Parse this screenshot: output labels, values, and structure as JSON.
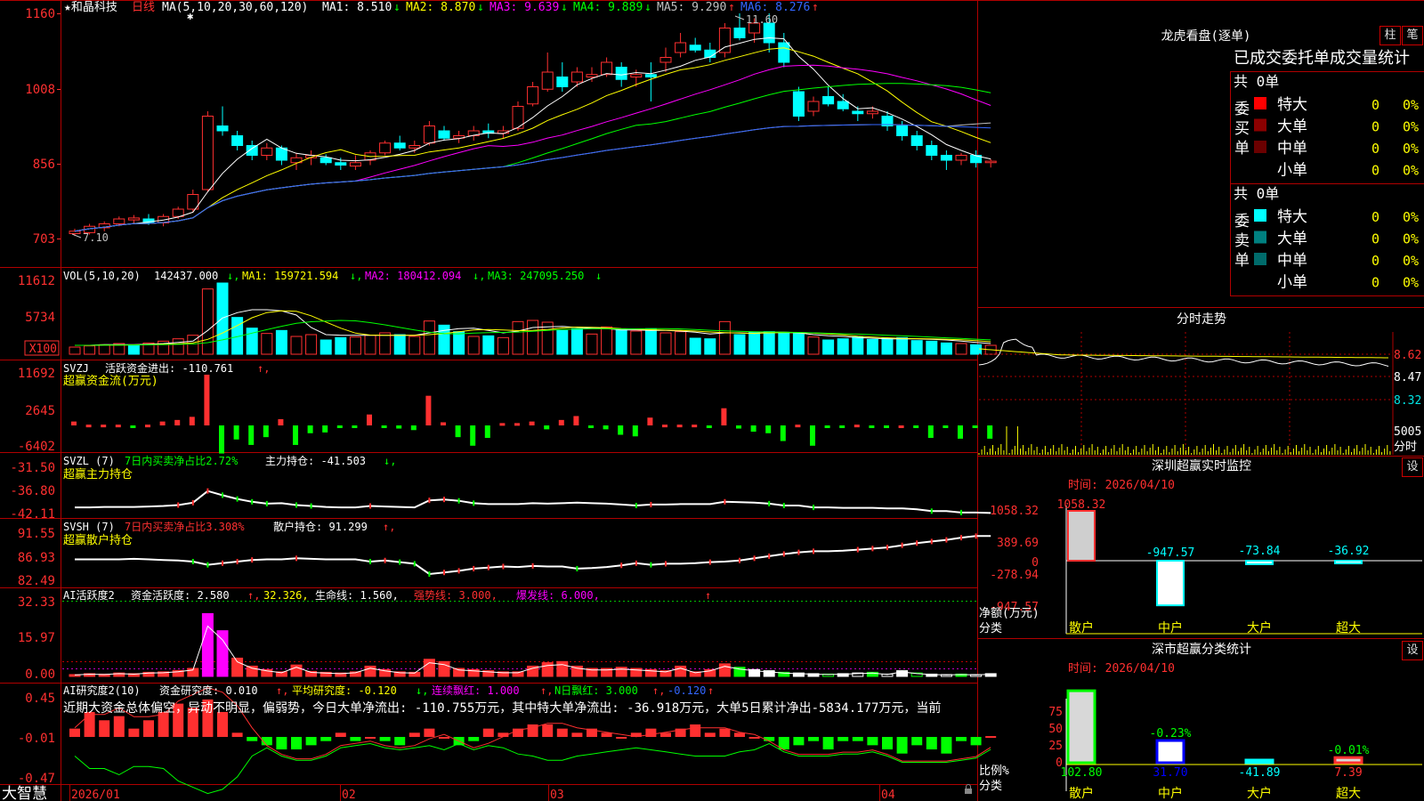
{
  "stock": {
    "title": "★和晶科技",
    "period": "日线",
    "ma_param": "MA(5,10,20,30,60,120)"
  },
  "ma_info": [
    {
      "label": "MA1: 8.510",
      "arrow": "↓",
      "color": "#ffffff"
    },
    {
      "label": "MA2: 8.870",
      "arrow": "↓",
      "color": "#ffff00"
    },
    {
      "label": "MA3: 9.639",
      "arrow": "↓",
      "color": "#ff00ff"
    },
    {
      "label": "MA4: 9.889",
      "arrow": "↓",
      "color": "#00ff00"
    },
    {
      "label": "MA5: 9.290",
      "arrow": "↑",
      "color": "#c0c0c0"
    },
    {
      "label": "MA6: 8.276",
      "arrow": "↑",
      "color": "#3366ff"
    }
  ],
  "price_axis": [
    "1160",
    "1008",
    "856",
    "703"
  ],
  "high_label": "11.60",
  "low_label": "7.10",
  "date_axis": [
    "2026/01",
    "02",
    "03",
    "04"
  ],
  "vol_info": {
    "name": "VOL(5,10,20)",
    "v": "142437.000",
    "ma1": "MA1: 159721.594",
    "ma2": "MA2: 180412.094",
    "ma3": "MA3: 247095.250"
  },
  "vol_axis": [
    "11612",
    "5734",
    "X100"
  ],
  "svzj": {
    "name": "SVZJ",
    "text": "活跃资金进出: -110.761",
    "sub": "超赢资金流(万元)",
    "axis": [
      "11692",
      "2645",
      "-6402"
    ]
  },
  "svzl": {
    "name": "SVZL (7)",
    "pct": "7日内买卖净占比2.72%",
    "text": "主力持仓: -41.503",
    "sub": "超赢主力持仓",
    "axis": [
      "-31.50",
      "-36.80",
      "-42.11"
    ]
  },
  "svsh": {
    "name": "SVSH (7)",
    "pct": "7日内买卖净占比3.308%",
    "text": "散户持仓: 91.299",
    "sub": "超赢散户持仓",
    "axis": [
      "91.55",
      "86.93",
      "82.49"
    ]
  },
  "ai_active": {
    "name": "AI活跃度2",
    "t1": "资金活跃度: 2.580",
    "t2": "32.326,",
    "t3": "生命线: 1.560,",
    "t4": "强势线: 3.000,",
    "t5": "爆发线: 6.000,",
    "axis": [
      "32.33",
      "15.97",
      "0.00"
    ]
  },
  "ai_research": {
    "name": "AI研究度2(10)",
    "t1": "资金研究度: 0.010",
    "t2": "平均研究度: -0.120",
    "t3": "连续飘红: 1.000",
    "t4": "N日飘红: 3.000",
    "t5": "-0.120",
    "axis": [
      "0.45",
      "-0.01",
      "-0.47"
    ]
  },
  "commentary": "近期大资金总体偏空，异动不明显，偏弱势，今日大单净流出: -110.755万元，其中特大单净流出: -36.918万元，大单5日累计净出-5834.177万元，当前",
  "brand": "大智慧",
  "right": {
    "lhb_title": "龙虎看盘(逐单)",
    "btn_zhu": "柱",
    "btn_bi": "笔",
    "tabs_text": "已成交委托单成交量统计",
    "buy": {
      "label": "委买单",
      "total": "共 0单",
      "rows": [
        {
          "name": "特大",
          "count": "0",
          "pct": "0%"
        },
        {
          "name": "大单",
          "count": "0",
          "pct": "0%"
        },
        {
          "name": "中单",
          "count": "0",
          "pct": "0%"
        },
        {
          "name": "小单",
          "count": "0",
          "pct": "0%"
        }
      ]
    },
    "sell": {
      "label": "委卖单",
      "total": "共 0单",
      "rows": [
        {
          "name": "特大",
          "count": "0",
          "pct": "0%"
        },
        {
          "name": "大单",
          "count": "0",
          "pct": "0%"
        },
        {
          "name": "中单",
          "count": "0",
          "pct": "0%"
        },
        {
          "name": "小单",
          "count": "0",
          "pct": "0%"
        }
      ]
    },
    "intraday": {
      "title": "分时走势",
      "axis": [
        "8.62",
        "8.47",
        "8.32"
      ],
      "vol": "5005",
      "unit": "分时"
    },
    "monitor": {
      "title": "深圳超赢实时监控",
      "btn": "设",
      "time": "时间: 2026/04/10",
      "axis": [
        "1058.32",
        "389.69",
        "0",
        "-278.94",
        "-947.57"
      ],
      "ylabel": "净额(万元)",
      "xlabel": "分类",
      "cats": [
        "散户",
        "中户",
        "大户",
        "超大"
      ],
      "values": [
        1058.32,
        -947.57,
        -73.84,
        -36.92
      ],
      "labels": [
        "1058.32",
        "-947.57",
        "-73.84",
        "-36.92"
      ]
    },
    "category": {
      "title": "深市超赢分类统计",
      "btn": "设",
      "time": "时间: 2026/04/10",
      "axis": [
        "75",
        "50",
        "25",
        "0"
      ],
      "ylabel": "比例%",
      "xlabel": "分类",
      "cats": [
        "散户",
        "中户",
        "大户",
        "超大"
      ],
      "values": [
        102.8,
        31.7,
        -41.89,
        7.39
      ],
      "labels": [
        "102.80",
        "31.70",
        "-41.89",
        "7.39"
      ],
      "top_labels": [
        "",
        "-0.23%",
        "",
        "-0.01%"
      ]
    }
  },
  "chart_data": {
    "type": "candlestick",
    "title": "和晶科技 日线",
    "ylim": [
      6.9,
      11.7
    ],
    "ohlc": [
      [
        7.1,
        7.2,
        7.05,
        7.15
      ],
      [
        7.12,
        7.3,
        7.08,
        7.25
      ],
      [
        7.22,
        7.35,
        7.15,
        7.3
      ],
      [
        7.3,
        7.45,
        7.25,
        7.4
      ],
      [
        7.38,
        7.48,
        7.3,
        7.42
      ],
      [
        7.4,
        7.5,
        7.28,
        7.32
      ],
      [
        7.32,
        7.5,
        7.25,
        7.45
      ],
      [
        7.45,
        7.65,
        7.4,
        7.6
      ],
      [
        7.6,
        8.0,
        7.55,
        7.9
      ],
      [
        8.0,
        9.6,
        7.95,
        9.5
      ],
      [
        9.3,
        9.7,
        9.1,
        9.2
      ],
      [
        9.1,
        9.2,
        8.8,
        8.9
      ],
      [
        8.9,
        9.0,
        8.6,
        8.7
      ],
      [
        8.7,
        8.95,
        8.6,
        8.85
      ],
      [
        8.85,
        8.9,
        8.5,
        8.6
      ],
      [
        8.55,
        8.75,
        8.4,
        8.65
      ],
      [
        8.65,
        8.8,
        8.5,
        8.7
      ],
      [
        8.65,
        8.72,
        8.5,
        8.55
      ],
      [
        8.55,
        8.65,
        8.4,
        8.5
      ],
      [
        8.48,
        8.7,
        8.4,
        8.55
      ],
      [
        8.6,
        8.8,
        8.5,
        8.75
      ],
      [
        8.75,
        9.0,
        8.7,
        8.95
      ],
      [
        8.95,
        9.1,
        8.8,
        8.85
      ],
      [
        8.85,
        9.0,
        8.75,
        8.9
      ],
      [
        8.95,
        9.4,
        8.9,
        9.3
      ],
      [
        9.2,
        9.3,
        9.0,
        9.05
      ],
      [
        9.05,
        9.2,
        8.95,
        9.1
      ],
      [
        9.1,
        9.3,
        9.0,
        9.2
      ],
      [
        9.2,
        9.35,
        9.05,
        9.15
      ],
      [
        9.15,
        9.3,
        9.05,
        9.2
      ],
      [
        9.25,
        9.8,
        9.2,
        9.7
      ],
      [
        9.75,
        10.2,
        9.7,
        10.1
      ],
      [
        10.05,
        10.8,
        10.0,
        10.4
      ],
      [
        10.3,
        10.6,
        10.0,
        10.1
      ],
      [
        10.2,
        10.5,
        10.1,
        10.4
      ],
      [
        10.3,
        10.5,
        10.2,
        10.35
      ],
      [
        10.35,
        10.7,
        10.3,
        10.6
      ],
      [
        10.5,
        10.6,
        10.1,
        10.25
      ],
      [
        10.3,
        10.45,
        10.1,
        10.35
      ],
      [
        10.35,
        10.6,
        9.8,
        10.3
      ],
      [
        10.6,
        10.9,
        10.4,
        10.7
      ],
      [
        10.8,
        11.2,
        10.7,
        11.0
      ],
      [
        10.95,
        11.1,
        10.8,
        10.85
      ],
      [
        10.85,
        11.0,
        10.6,
        10.7
      ],
      [
        10.8,
        11.4,
        10.7,
        11.3
      ],
      [
        11.3,
        11.6,
        11.05,
        11.1
      ],
      [
        11.2,
        11.5,
        11.0,
        11.4
      ],
      [
        11.4,
        11.6,
        10.8,
        11.0
      ],
      [
        11.0,
        11.2,
        10.5,
        10.6
      ],
      [
        10.0,
        10.1,
        9.4,
        9.5
      ],
      [
        9.6,
        9.9,
        9.5,
        9.8
      ],
      [
        9.9,
        10.1,
        9.7,
        9.75
      ],
      [
        9.8,
        9.95,
        9.6,
        9.65
      ],
      [
        9.6,
        9.7,
        9.4,
        9.55
      ],
      [
        9.55,
        9.7,
        9.45,
        9.6
      ],
      [
        9.5,
        9.6,
        9.2,
        9.3
      ],
      [
        9.3,
        9.4,
        9.0,
        9.1
      ],
      [
        9.1,
        9.2,
        8.8,
        8.9
      ],
      [
        8.9,
        9.0,
        8.6,
        8.7
      ],
      [
        8.7,
        8.8,
        8.4,
        8.6
      ],
      [
        8.6,
        8.75,
        8.5,
        8.7
      ],
      [
        8.7,
        8.8,
        8.45,
        8.55
      ],
      [
        8.55,
        8.62,
        8.45,
        8.58
      ]
    ],
    "volume": [
      [
        1.2,
        1
      ],
      [
        1.4,
        1
      ],
      [
        1.6,
        1
      ],
      [
        1.8,
        1
      ],
      [
        1.5,
        0
      ],
      [
        1.9,
        1
      ],
      [
        2.2,
        1
      ],
      [
        2.6,
        1
      ],
      [
        3.2,
        1
      ],
      [
        11.0,
        1
      ],
      [
        12.0,
        0
      ],
      [
        6.2,
        0
      ],
      [
        4.4,
        0
      ],
      [
        3.5,
        1
      ],
      [
        4.0,
        0
      ],
      [
        3.0,
        1
      ],
      [
        3.3,
        1
      ],
      [
        2.4,
        0
      ],
      [
        2.8,
        0
      ],
      [
        2.9,
        1
      ],
      [
        3.2,
        1
      ],
      [
        3.6,
        1
      ],
      [
        3.3,
        0
      ],
      [
        3.0,
        1
      ],
      [
        5.6,
        1
      ],
      [
        4.9,
        0
      ],
      [
        3.8,
        0
      ],
      [
        3.0,
        1
      ],
      [
        3.1,
        0
      ],
      [
        2.8,
        1
      ],
      [
        5.5,
        1
      ],
      [
        5.7,
        1
      ],
      [
        5.4,
        1
      ],
      [
        4.0,
        0
      ],
      [
        4.3,
        0
      ],
      [
        3.4,
        1
      ],
      [
        4.6,
        1
      ],
      [
        4.1,
        0
      ],
      [
        3.9,
        1
      ],
      [
        4.3,
        0
      ],
      [
        3.6,
        1
      ],
      [
        3.8,
        1
      ],
      [
        2.7,
        0
      ],
      [
        2.6,
        0
      ],
      [
        5.5,
        1
      ],
      [
        3.3,
        0
      ],
      [
        3.7,
        0
      ],
      [
        3.8,
        0
      ],
      [
        3.7,
        0
      ],
      [
        3.5,
        0
      ],
      [
        2.9,
        1
      ],
      [
        2.4,
        0
      ],
      [
        2.6,
        0
      ],
      [
        2.9,
        0
      ],
      [
        2.5,
        0
      ],
      [
        2.7,
        0
      ],
      [
        2.8,
        0
      ],
      [
        2.3,
        0
      ],
      [
        2.2,
        0
      ],
      [
        1.9,
        0
      ],
      [
        1.8,
        1
      ],
      [
        1.6,
        0
      ],
      [
        1.5,
        1
      ]
    ],
    "svzj": [
      0.5,
      0.1,
      0.1,
      0.1,
      -0.2,
      0.1,
      0.5,
      0.7,
      1.1,
      6.5,
      -3.6,
      -1.8,
      -2.5,
      -1.5,
      0.8,
      -2.5,
      -1.0,
      -0.9,
      -0.3,
      -0.1,
      1.4,
      -0.3,
      -0.4,
      -0.6,
      3.8,
      0.4,
      -1.5,
      -2.6,
      -1.6,
      0.3,
      0.3,
      0.5,
      -0.5,
      0.7,
      1.2,
      -0.3,
      -0.5,
      -1.2,
      -1.4,
      1.0,
      0.1,
      0.1,
      0.1,
      -0.2,
      2.2,
      -0.4,
      -0.8,
      -1.0,
      -2.0,
      0.1,
      -2.6,
      -0.3,
      -0.2,
      0.1,
      -0.1,
      -0.1,
      0.0,
      -0.1,
      -1.6,
      -0.1,
      -1.7,
      -0.1,
      -1.7
    ],
    "vol_ma1": [
      1.5,
      1.5,
      1.6,
      1.6,
      1.6,
      1.7,
      1.8,
      2.0,
      2.2,
      4.0,
      6.1,
      7.0,
      7.5,
      7.5,
      7.3,
      6.6,
      4.5,
      3.3,
      3.2,
      3.2,
      3.2,
      3.2,
      3.2,
      3.2,
      3.6,
      4.0,
      4.3,
      4.4,
      4.0,
      3.6,
      3.9,
      4.5,
      4.6,
      4.7,
      4.5,
      4.4,
      4.3,
      4.1,
      4.1,
      4.0,
      4.0,
      3.9,
      3.7,
      3.4,
      3.6,
      3.6,
      3.5,
      3.7,
      3.7,
      3.6,
      3.3,
      3.1,
      3.0,
      2.8,
      2.7,
      2.6,
      2.6,
      2.6,
      2.5,
      2.4,
      2.2,
      2.0,
      1.8
    ],
    "svzl": [
      -41.0,
      -41.0,
      -40.9,
      -40.9,
      -40.9,
      -40.8,
      -40.7,
      -40.5,
      -40.0,
      -37.5,
      -38.4,
      -39.2,
      -39.8,
      -40.2,
      -40.1,
      -40.5,
      -40.7,
      -40.9,
      -41.0,
      -41.0,
      -40.7,
      -40.8,
      -40.9,
      -41.0,
      -39.5,
      -39.3,
      -39.6,
      -40.1,
      -40.3,
      -40.3,
      -40.3,
      -40.1,
      -40.2,
      -40.1,
      -40.0,
      -40.1,
      -40.2,
      -40.4,
      -40.6,
      -40.4,
      -40.4,
      -40.3,
      -40.3,
      -40.3,
      -39.8,
      -39.9,
      -40.0,
      -40.2,
      -40.6,
      -40.6,
      -41.0,
      -41.0,
      -41.1,
      -41.1,
      -41.1,
      -41.2,
      -41.2,
      -41.4,
      -41.8,
      -41.8,
      -42.1,
      -42.1,
      -42.2
    ],
    "svsh": [
      87.0,
      87.0,
      87.0,
      87.0,
      87.1,
      87.0,
      86.9,
      86.8,
      86.6,
      86.0,
      86.3,
      86.6,
      86.9,
      87.0,
      87.0,
      87.2,
      87.1,
      87.0,
      87.0,
      87.0,
      86.6,
      86.8,
      86.5,
      86.2,
      84.3,
      84.6,
      84.9,
      85.3,
      85.5,
      85.7,
      85.6,
      85.8,
      85.7,
      85.7,
      85.3,
      85.4,
      85.6,
      85.9,
      86.3,
      86.0,
      86.2,
      86.2,
      86.3,
      86.5,
      86.6,
      86.8,
      87.2,
      87.6,
      88.0,
      88.3,
      88.5,
      88.5,
      88.6,
      88.8,
      89.0,
      89.2,
      89.6,
      90.0,
      90.3,
      90.6,
      91.0,
      91.3,
      91.3
    ],
    "ai_active": [
      0.8,
      1.2,
      1.0,
      1.5,
      1.2,
      1.8,
      2.0,
      2.6,
      3.5,
      27.5,
      20.0,
      8.0,
      4.5,
      3.0,
      2.0,
      5.0,
      2.2,
      1.8,
      1.5,
      2.0,
      4.5,
      3.0,
      2.0,
      1.8,
      7.5,
      6.5,
      3.5,
      3.0,
      2.5,
      2.0,
      2.0,
      4.5,
      6.0,
      6.5,
      4.5,
      3.5,
      3.5,
      4.0,
      3.5,
      3.0,
      2.5,
      4.5,
      2.0,
      3.0,
      5.5,
      4.0,
      3.0,
      2.5,
      1.8,
      1.5,
      1.2,
      1.0,
      1.2,
      1.5,
      1.8,
      1.0,
      2.5,
      1.5,
      1.0,
      0.8,
      1.0,
      0.8,
      1.2
    ],
    "ai_res": [
      0.1,
      0.3,
      0.2,
      0.25,
      0.1,
      0.2,
      0.3,
      0.4,
      0.35,
      0.45,
      0.3,
      0.05,
      -0.05,
      -0.1,
      -0.15,
      -0.15,
      -0.1,
      -0.05,
      0.05,
      -0.05,
      0.0,
      -0.05,
      -0.1,
      0.05,
      0.1,
      0.0,
      -0.1,
      -0.05,
      0.1,
      0.05,
      0.1,
      0.15,
      0.15,
      0.1,
      0.05,
      0.1,
      0.05,
      0.0,
      0.05,
      0.1,
      0.05,
      0.1,
      0.15,
      0.05,
      0.1,
      0.05,
      0.0,
      -0.05,
      -0.15,
      -0.1,
      -0.05,
      -0.15,
      -0.05,
      -0.05,
      -0.1,
      -0.15,
      -0.2,
      -0.1,
      -0.15,
      -0.2,
      -0.05,
      -0.1,
      0.01
    ]
  }
}
